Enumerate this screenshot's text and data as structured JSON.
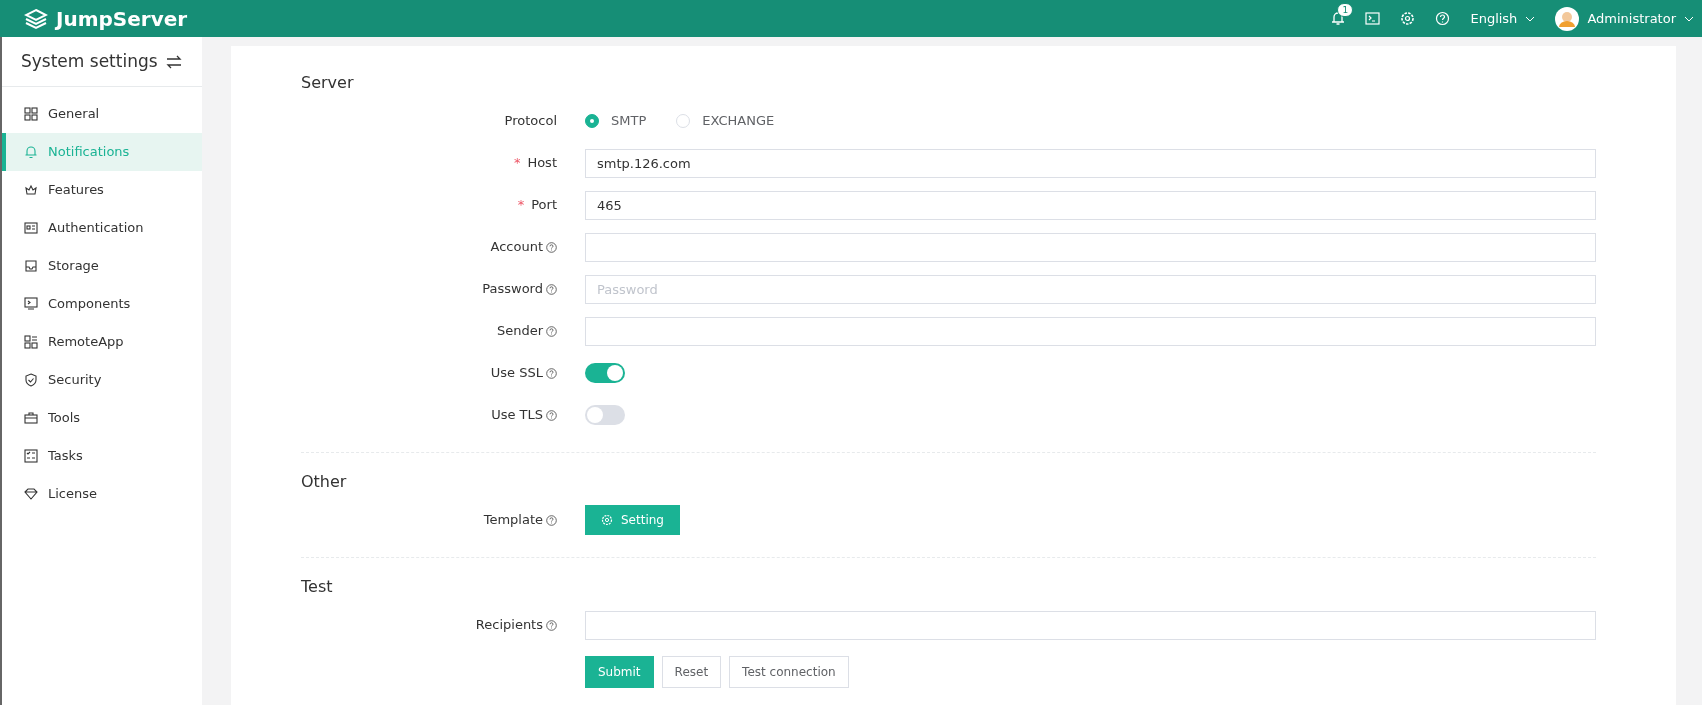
{
  "header": {
    "logo": "JumpServer",
    "notification_count": "1",
    "language": "English",
    "user": "Administrator"
  },
  "sidebar": {
    "title": "System settings",
    "items": [
      {
        "label": "General",
        "selected": false
      },
      {
        "label": "Notifications",
        "selected": true
      },
      {
        "label": "Features",
        "selected": false
      },
      {
        "label": "Authentication",
        "selected": false
      },
      {
        "label": "Storage",
        "selected": false
      },
      {
        "label": "Components",
        "selected": false
      },
      {
        "label": "RemoteApp",
        "selected": false
      },
      {
        "label": "Security",
        "selected": false
      },
      {
        "label": "Tools",
        "selected": false
      },
      {
        "label": "Tasks",
        "selected": false
      },
      {
        "label": "License",
        "selected": false
      }
    ]
  },
  "sections": [
    {
      "title": "Server",
      "fields": [
        {
          "kind": "radio",
          "label": "Protocol",
          "options": [
            {
              "label": "SMTP",
              "selected": true
            },
            {
              "label": "EXCHANGE",
              "selected": false
            }
          ]
        },
        {
          "kind": "text",
          "label": "Host",
          "required_mark": "*",
          "value": "smtp.126.com"
        },
        {
          "kind": "text",
          "label": "Port",
          "required_mark": "*",
          "value": "465"
        },
        {
          "kind": "text",
          "label": "Account",
          "help": true
        },
        {
          "kind": "text",
          "label": "Password",
          "help": true,
          "placeholder": "Password"
        },
        {
          "kind": "text",
          "label": "Sender",
          "help": true
        },
        {
          "kind": "switch",
          "label": "Use SSL",
          "help": true,
          "on": true
        },
        {
          "kind": "switch",
          "label": "Use TLS",
          "help": true,
          "on": false
        }
      ]
    },
    {
      "title": "Other",
      "fields": [
        {
          "kind": "button",
          "label": "Template",
          "help": true,
          "button": "Setting"
        }
      ]
    },
    {
      "title": "Test",
      "fields": [
        {
          "kind": "text",
          "label": "Recipients",
          "help": true
        }
      ]
    }
  ],
  "actions": [
    {
      "label": "Submit",
      "primary": true
    },
    {
      "label": "Reset",
      "primary": false
    },
    {
      "label": "Test connection",
      "primary": false
    }
  ]
}
